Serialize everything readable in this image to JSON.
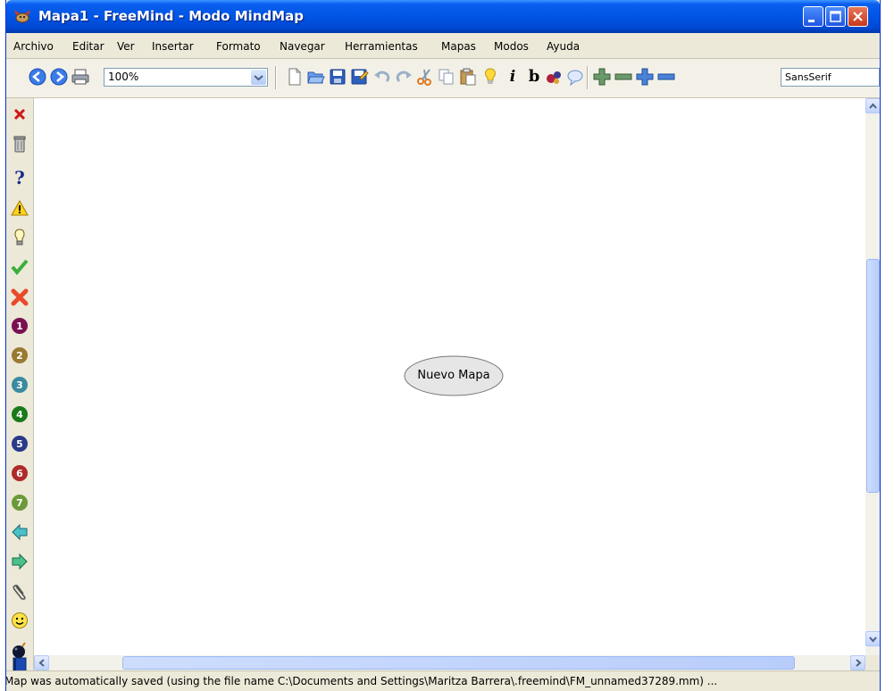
{
  "window": {
    "title": "Mapa1 - FreeMind - Modo MindMap"
  },
  "menu": [
    "Archivo",
    "Editar",
    "Ver",
    "Insertar",
    "Formato",
    "Navegar",
    "Herramientas",
    "Mapas",
    "Modos",
    "Ayuda"
  ],
  "toolbar": {
    "zoom_value": "100%",
    "font_value": "SansSerif",
    "italic_label": "i",
    "bold_label": "b"
  },
  "left_icons": [
    "delete-icon",
    "trash-icon",
    "question-icon",
    "warning-icon",
    "lightbulb-icon",
    "checkmark-icon",
    "cross-icon",
    "priority-1-icon",
    "priority-2-icon",
    "priority-3-icon",
    "priority-4-icon",
    "priority-5-icon",
    "priority-6-icon",
    "priority-7-icon",
    "arrow-left-icon",
    "arrow-right-icon",
    "paperclip-icon",
    "smiley-icon",
    "bomb-icon",
    "book-icon"
  ],
  "priority_numbers": [
    "1",
    "2",
    "3",
    "4",
    "5",
    "6",
    "7"
  ],
  "canvas": {
    "root_node": "Nuevo Mapa"
  },
  "status": {
    "text": "Map was automatically saved (using the file name C:\\Documents and Settings\\Maritza Barrera\\.freemind\\FM_unnamed37289.mm) ..."
  },
  "colors": {
    "titlebar": "#0055e5",
    "node_fill": "#e6e6e6",
    "accent": "#316ac5"
  }
}
